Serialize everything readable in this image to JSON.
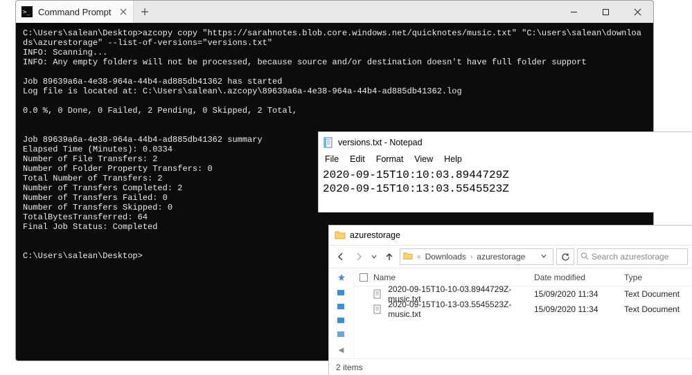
{
  "cmd": {
    "tab_title": "Command Prompt",
    "lines": "C:\\Users\\salean\\Desktop>azcopy copy \"https://sarahnotes.blob.core.windows.net/quicknotes/music.txt\" \"C:\\users\\salean\\downloads\\azurestorage\" --list-of-versions=\"versions.txt\"\nINFO: Scanning...\nINFO: Any empty folders will not be processed, because source and/or destination doesn't have full folder support\n\nJob 89639a6a-4e38-964a-44b4-ad885db41362 has started\nLog file is located at: C:\\Users\\salean\\.azcopy\\89639a6a-4e38-964a-44b4-ad885db41362.log\n\n0.0 %, 0 Done, 0 Failed, 2 Pending, 0 Skipped, 2 Total,\n\n\nJob 89639a6a-4e38-964a-44b4-ad885db41362 summary\nElapsed Time (Minutes): 0.0334\nNumber of File Transfers: 2\nNumber of Folder Property Transfers: 0\nTotal Number of Transfers: 2\nNumber of Transfers Completed: 2\nNumber of Transfers Failed: 0\nNumber of Transfers Skipped: 0\nTotalBytesTransferred: 64\nFinal Job Status: Completed\n\n\nC:\\Users\\salean\\Desktop>"
  },
  "notepad": {
    "title": "versions.txt - Notepad",
    "menus": {
      "file": "File",
      "edit": "Edit",
      "format": "Format",
      "view": "View",
      "help": "Help"
    },
    "content": "2020-09-15T10:10:03.8944729Z\n2020-09-15T10:13:03.5545523Z"
  },
  "explorer": {
    "title": "azurestorage",
    "breadcrumb": {
      "prefix": "«",
      "p1": "Downloads",
      "sep": "›",
      "p2": "azurestorage"
    },
    "search_placeholder": "Search azurestorage",
    "columns": {
      "name": "Name",
      "date": "Date modified",
      "type": "Type"
    },
    "rows": [
      {
        "name": "2020-09-15T10-10-03.8944729Z-music.txt",
        "date": "15/09/2020 11:34",
        "type": "Text Document"
      },
      {
        "name": "2020-09-15T10-13-03.5545523Z-music.txt",
        "date": "15/09/2020 11:34",
        "type": "Text Document"
      }
    ],
    "status": "2 items"
  }
}
